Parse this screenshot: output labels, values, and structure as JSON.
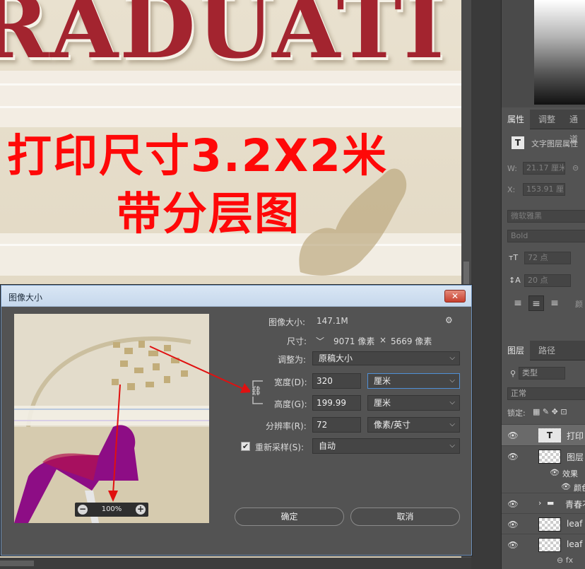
{
  "canvas": {
    "title_art": "RADUATI",
    "promo_line1": "打印尺寸3.2X2米",
    "promo_line2": "带分层图"
  },
  "dialog": {
    "title": "图像大小",
    "close_label": "✕",
    "image_size_label": "图像大小:",
    "image_size_value": "147.1M",
    "gear_icon": "⚙",
    "dimensions_label": "尺寸:",
    "dimensions_chevron": "﹀",
    "dimensions_width": "9071 像素",
    "dimensions_x": "×",
    "dimensions_height": "5669 像素",
    "fit_to_label": "调整为:",
    "fit_to_value": "原稿大小",
    "width_label": "宽度(D):",
    "width_value": "320",
    "width_unit": "厘米",
    "height_label": "高度(G):",
    "height_value": "199.99",
    "height_unit": "厘米",
    "resolution_label": "分辨率(R):",
    "resolution_value": "72",
    "resolution_unit": "像素/英寸",
    "resample_check": "✔",
    "resample_label": "重新采样(S):",
    "resample_value": "自动",
    "ok_label": "确定",
    "cancel_label": "取消",
    "preview_zoom": "100%",
    "zoom_minus": "−",
    "zoom_plus": "+",
    "link_glyph": "⛓"
  },
  "properties": {
    "tabs": [
      "属性",
      "调整",
      "通道"
    ],
    "type_icon": "T",
    "layer_kind": "文字图层属性",
    "w_label": "W:",
    "w_value": "21.17 厘米",
    "link_glyph": "⊝",
    "x_label": "X:",
    "x_value": "153.91 厘",
    "font_family": "微软雅黑",
    "font_style": "Bold",
    "font_size_icon": "тT",
    "font_size": "72 点",
    "leading_icon": "↕A",
    "leading": "20 点",
    "color_label": "颜"
  },
  "layers": {
    "tabs": [
      "图层",
      "路径"
    ],
    "search_icon": "⚲",
    "filter_kind": "类型",
    "blend_mode": "正常",
    "lock_label": "锁定:",
    "lock_icons": "▦ ✎ ✥ ⊡",
    "rows": [
      {
        "name": "打印",
        "type": "text"
      },
      {
        "name": "图层",
        "type": "pixel"
      },
      {
        "name": "效果",
        "type": "effects"
      },
      {
        "name": "颜色",
        "type": "effect-item"
      },
      {
        "name": "青春不",
        "type": "group"
      },
      {
        "name": "leaf",
        "type": "pixel"
      },
      {
        "name": "leaf c",
        "type": "pixel"
      }
    ],
    "footer_icons": "⊖  fx"
  },
  "colors": {
    "promo_red": "#ff0808",
    "title_red": "#a3242f",
    "dialog_bg": "#535353",
    "arrow_red": "#e01010"
  }
}
